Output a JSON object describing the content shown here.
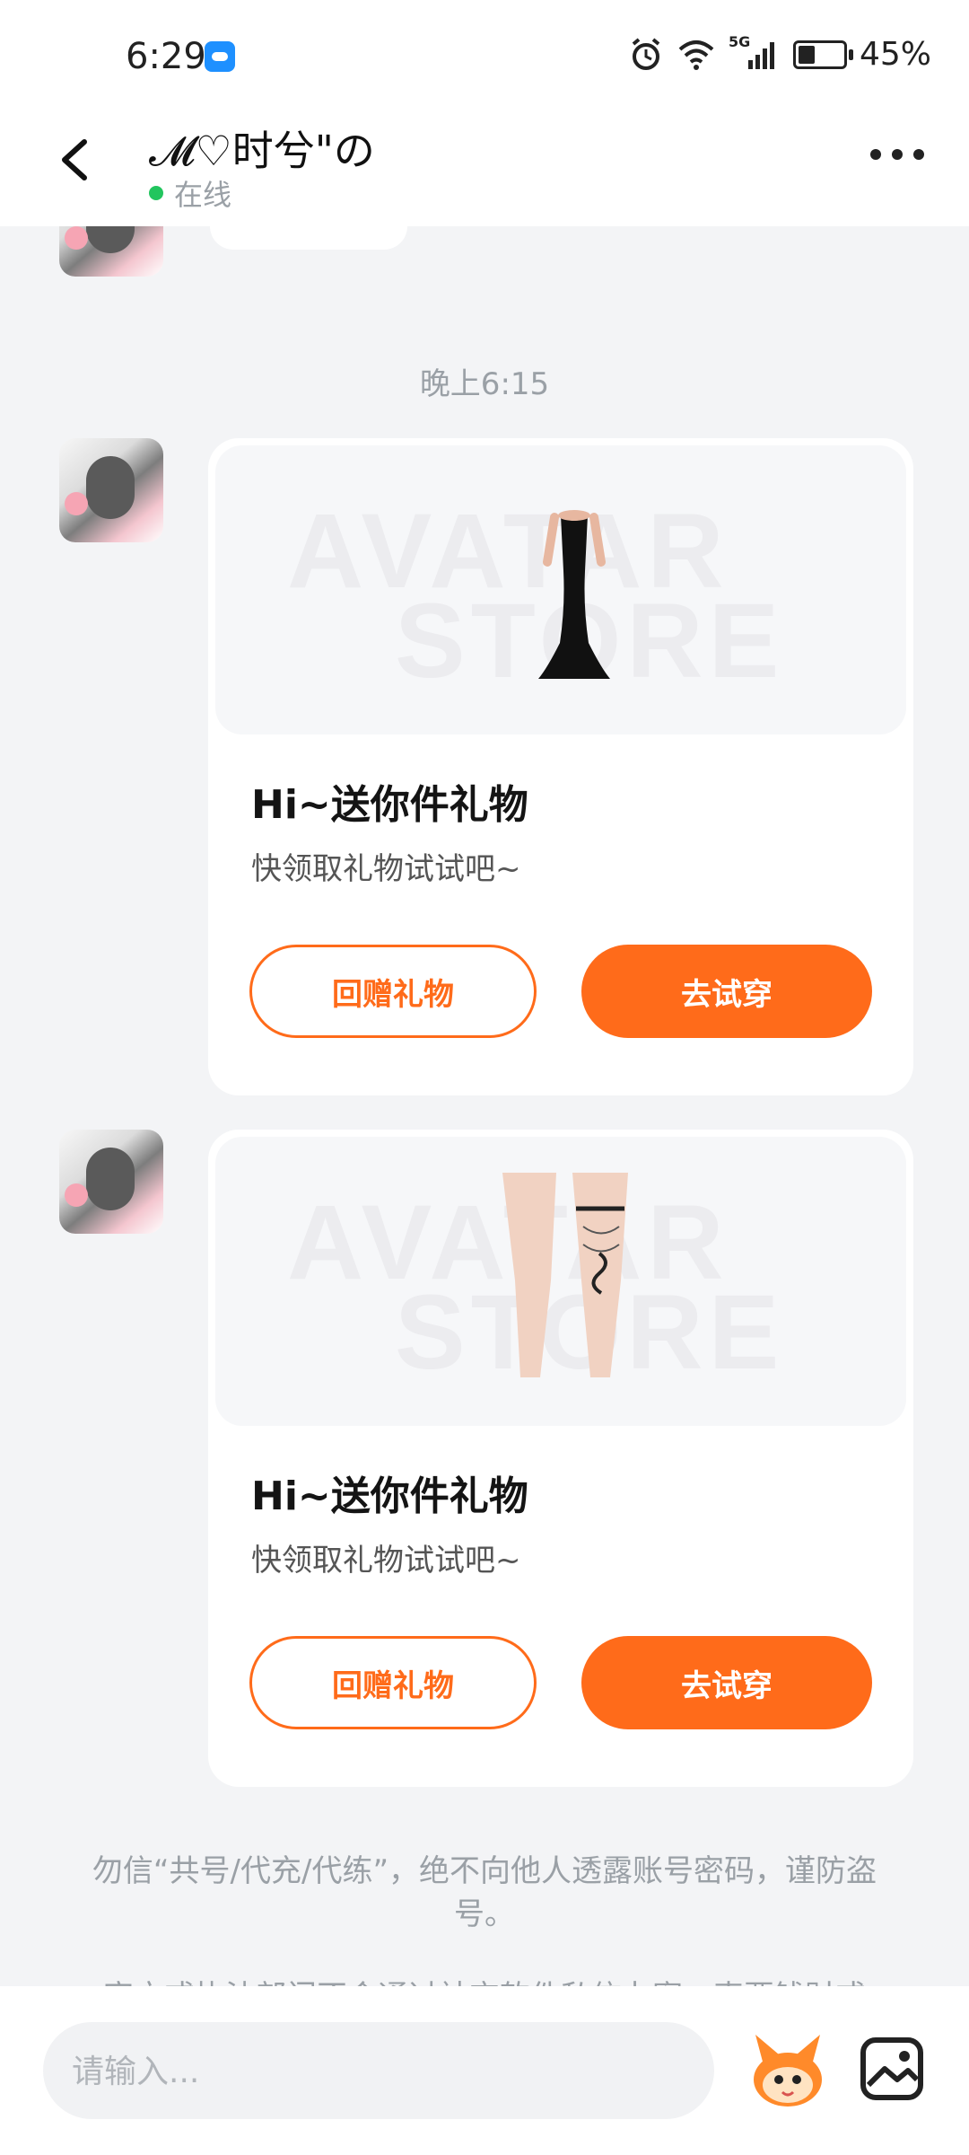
{
  "status_bar": {
    "time": "6:29",
    "signal_label": "5G",
    "battery": "45%"
  },
  "header": {
    "title": "𝓜♡时兮\"の",
    "presence": "在线"
  },
  "chat": {
    "timestamp": "晚上6:15",
    "cards": [
      {
        "title": "Hi~送你件礼物",
        "subtitle": "快领取礼物试试吧~",
        "watermark_top": "AVATAR",
        "watermark_bottom": "STORE",
        "secondary_button": "回赠礼物",
        "primary_button": "去试穿",
        "item": "black-dress"
      },
      {
        "title": "Hi~送你件礼物",
        "subtitle": "快领取礼物试试吧~",
        "watermark_top": "AVATAR",
        "watermark_bottom": "STORE",
        "secondary_button": "回赠礼物",
        "primary_button": "去试穿",
        "item": "legs-garter"
      }
    ],
    "notice": "勿信“共号/代充/代练”，绝不向他人透露账号密码，谨防盗号。",
    "notice_cut": "官方或执法部门不会通过社交软件私信办案、索要钱财或"
  },
  "input": {
    "placeholder": "请输入..."
  },
  "colors": {
    "accent": "#ff6b1a",
    "online": "#22c55e"
  }
}
